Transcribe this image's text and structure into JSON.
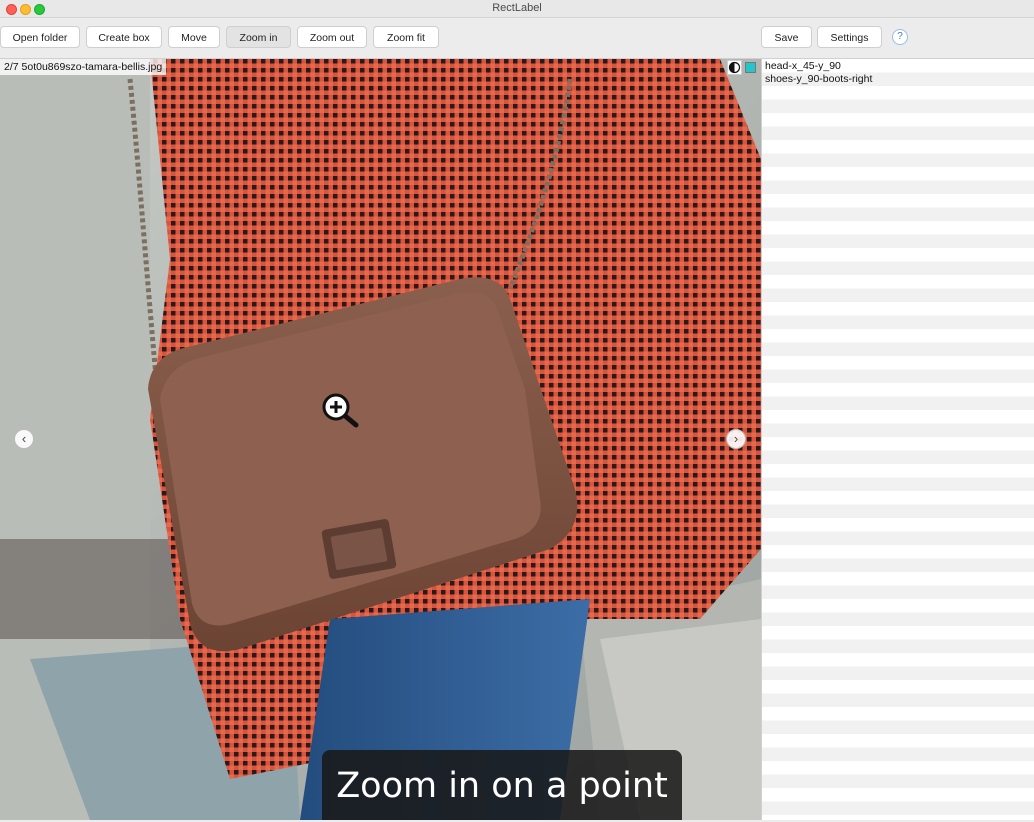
{
  "window": {
    "title": "RectLabel"
  },
  "toolbar": {
    "open_folder": "Open folder",
    "create_box": "Create box",
    "move": "Move",
    "zoom_in": "Zoom in",
    "zoom_out": "Zoom out",
    "zoom_fit": "Zoom fit",
    "save": "Save",
    "settings": "Settings",
    "help": "?"
  },
  "canvas": {
    "filename": "2/7 5ot0u869szo-tamara-bellis.jpg",
    "prev": "‹",
    "next": "›",
    "cursor_icon": "zoom-in-cursor-icon"
  },
  "labels": {
    "items": [
      {
        "label": "head-x_45-y_90"
      },
      {
        "label": "shoes-y_90-boots-right"
      }
    ],
    "selected_color": "#23c6cc"
  },
  "caption": {
    "text": "Zoom in on a point"
  },
  "colors": {
    "accent": "#3a7bd5",
    "coat_red": "#d8543d",
    "bag_brown": "#7a4f3e",
    "jeans_blue": "#2e5a8f"
  }
}
